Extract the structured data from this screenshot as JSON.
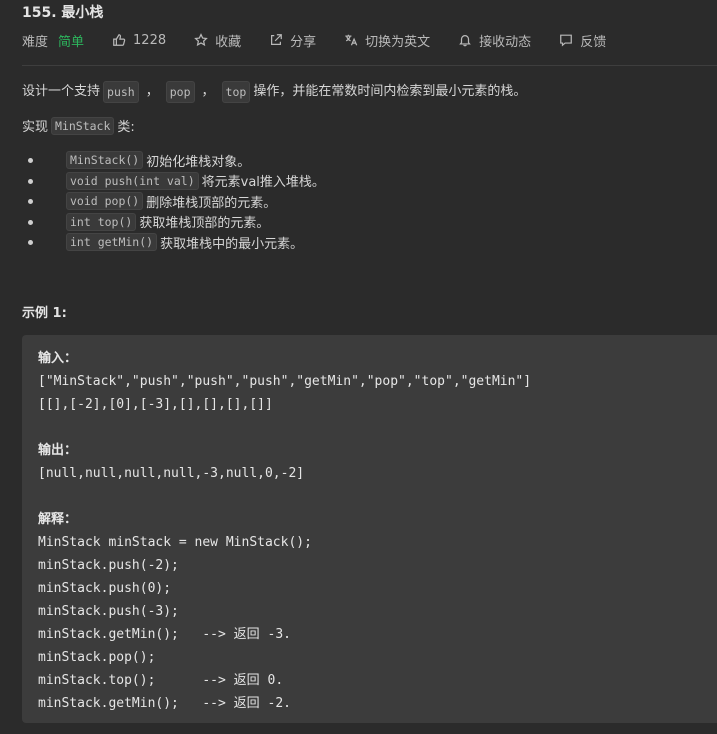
{
  "problem": {
    "title": "155. 最小栈",
    "difficulty_label": "难度",
    "difficulty": "简单"
  },
  "actions": {
    "likes": "1228",
    "favorite": "收藏",
    "share": "分享",
    "switch_lang": "切换为英文",
    "subscribe": "接收动态",
    "feedback": "反馈"
  },
  "description": {
    "p1_a": "设计一个支持",
    "push": "push",
    "comma1": "，",
    "pop": "pop",
    "comma2": "，",
    "top": "top",
    "p1_b": "操作，并能在常数时间内检索到最小元素的栈。",
    "impl_a": "实现",
    "impl_code": "MinStack",
    "impl_b": "类:"
  },
  "methods": [
    {
      "code": "MinStack()",
      "text": "初始化堆栈对象。"
    },
    {
      "code": "void push(int val)",
      "text": "将元素val推入堆栈。"
    },
    {
      "code": "void pop()",
      "text": "删除堆栈顶部的元素。"
    },
    {
      "code": "int top()",
      "text": "获取堆栈顶部的元素。"
    },
    {
      "code": "int getMin()",
      "text": "获取堆栈中的最小元素。"
    }
  ],
  "example": {
    "title": "示例 1:",
    "input_label": "输入：",
    "input_1": "[\"MinStack\",\"push\",\"push\",\"push\",\"getMin\",\"pop\",\"top\",\"getMin\"]",
    "input_2": "[[],[-2],[0],[-3],[],[],[],[]]",
    "output_label": "输出：",
    "output": "[null,null,null,null,-3,null,0,-2]",
    "explain_label": "解释：",
    "lines": [
      "MinStack minStack = new MinStack();",
      "minStack.push(-2);",
      "minStack.push(0);",
      "minStack.push(-3);",
      "minStack.getMin();   --> 返回 -3.",
      "minStack.pop();",
      "minStack.top();      --> 返回 0.",
      "minStack.getMin();   --> 返回 -2."
    ]
  }
}
